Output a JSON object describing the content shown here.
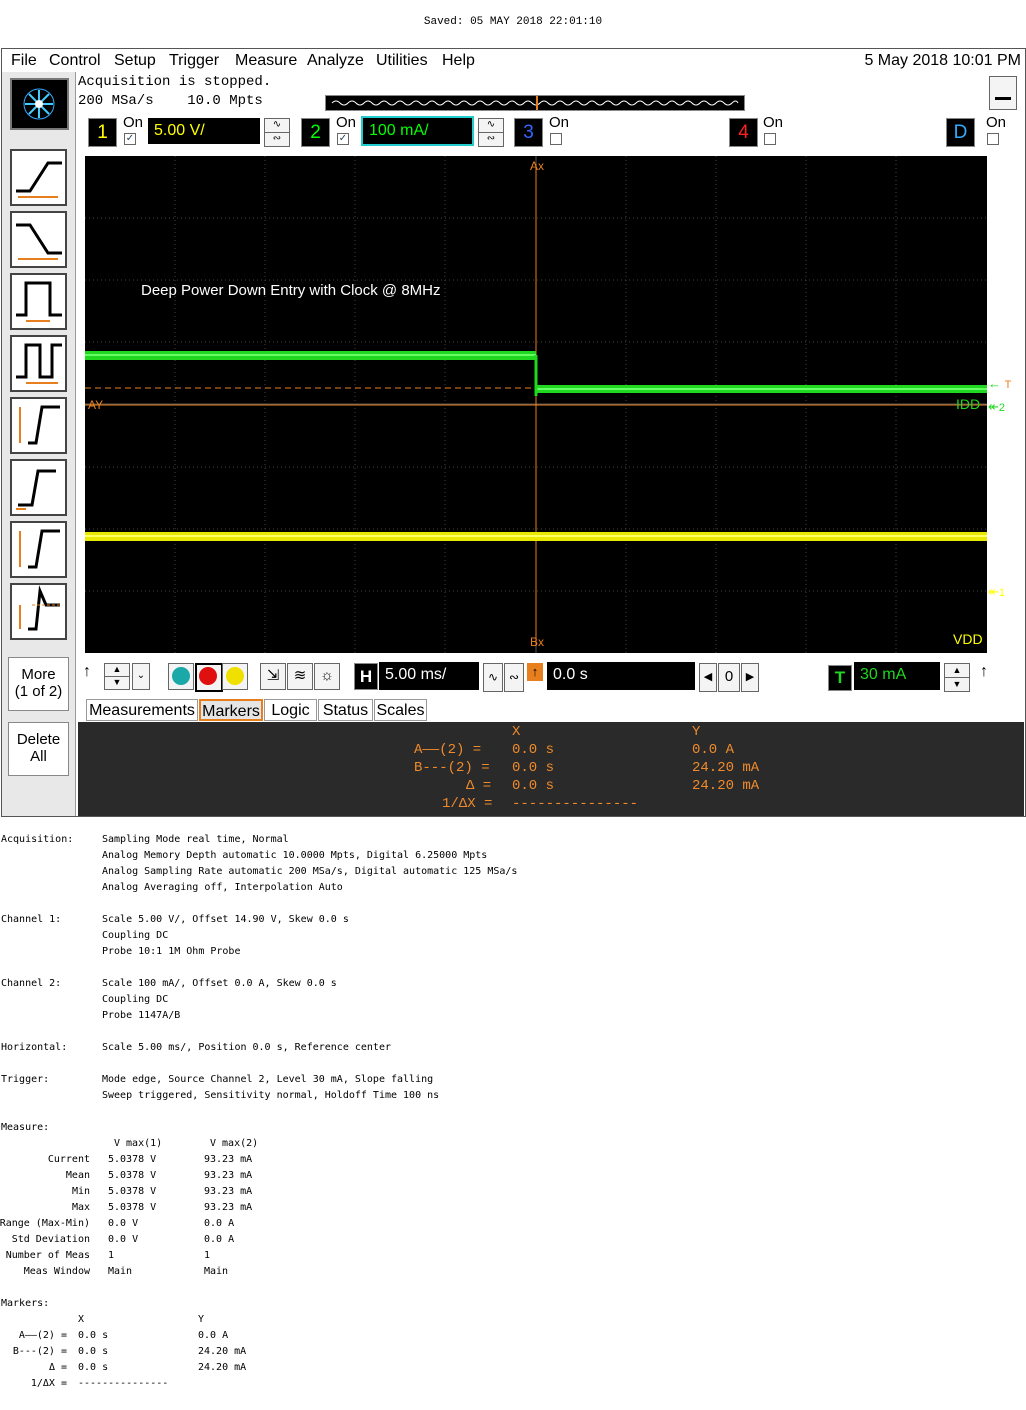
{
  "saved": "Saved:  05 MAY 2018  22:01:10",
  "menu": [
    "File",
    "Control",
    "Setup",
    "Trigger",
    "Measure",
    "Analyze",
    "Utilities",
    "Help"
  ],
  "datetime": "5 May 2018 10:01 PM",
  "acquisition": {
    "status": "Acquisition is stopped.",
    "rate": "200 MSa/s    10.0 Mpts"
  },
  "left_buttons": {
    "more": "More\n(1 of 2)",
    "delete": "Delete\nAll"
  },
  "channels": [
    {
      "num": "1",
      "on": "On",
      "scale": "5.00 V/",
      "color": "#ffff00"
    },
    {
      "num": "2",
      "on": "On",
      "scale": "100 mA/",
      "color": "#00ff00"
    },
    {
      "num": "3",
      "on": "On",
      "color": "#3060ff"
    },
    {
      "num": "4",
      "on": "On",
      "color": "#ff2020"
    },
    {
      "num": "D",
      "on": "On",
      "color": "#20a0ff"
    }
  ],
  "graticule": {
    "annotation": "Deep Power Down Entry with Clock @ 8MHz",
    "ax": "Ax",
    "bx": "Bx",
    "ay": "AY",
    "idd": "IDD",
    "vdd": "VDD",
    "trig_marker": "T",
    "ch2_marker": "2",
    "ch1_marker": "1"
  },
  "horizontal": {
    "h": "H",
    "scale": "5.00 ms/",
    "position": "0.0 s",
    "ref": "0"
  },
  "trigger": {
    "t": "T",
    "level": "30 mA"
  },
  "tabs": [
    "Measurements",
    "Markers",
    "Logic",
    "Status",
    "Scales"
  ],
  "markers_panel": {
    "x_hdr": "X",
    "y_hdr": "Y",
    "rows": [
      {
        "label": "A——(2) =",
        "x": "0.0 s",
        "y": "0.0 A"
      },
      {
        "label": "B---(2) =",
        "x": "0.0 s",
        "y": "24.20 mA"
      },
      {
        "label": "Δ =",
        "x": "0.0 s",
        "y": "24.20 mA"
      },
      {
        "label": "1/ΔX =",
        "x": "---------------",
        "y": ""
      }
    ]
  },
  "report": {
    "acq_label": "Acquisition:",
    "acq_lines": [
      "Sampling Mode real time, Normal",
      "Analog Memory Depth automatic 10.0000 Mpts, Digital 6.25000 Mpts",
      "Analog Sampling Rate automatic 200 MSa/s, Digital automatic 125 MSa/s",
      "Analog Averaging off, Interpolation Auto"
    ],
    "ch1_label": "Channel 1:",
    "ch1_lines": [
      "Scale 5.00 V/, Offset 14.90 V, Skew 0.0 s",
      "Coupling DC",
      "Probe 10:1 1M Ohm Probe"
    ],
    "ch2_label": "Channel 2:",
    "ch2_lines": [
      "Scale 100 mA/, Offset 0.0 A, Skew 0.0 s",
      "Coupling DC",
      "Probe 1147A/B"
    ],
    "hor_label": "Horizontal:",
    "hor_lines": [
      "Scale 5.00 ms/, Position 0.0 s, Reference center"
    ],
    "trig_label": "Trigger:",
    "trig_lines": [
      "Mode edge, Source Channel 2, Level 30 mA, Slope falling",
      "Sweep triggered, Sensitivity normal, Holdoff Time 100 ns"
    ],
    "meas_label": "Measure:",
    "meas_hdr": [
      "V max(1)",
      "V max(2)"
    ],
    "meas_rows": [
      [
        "Current",
        "5.0378 V",
        "93.23 mA"
      ],
      [
        "Mean",
        "5.0378 V",
        "93.23 mA"
      ],
      [
        "Min",
        "5.0378 V",
        "93.23 mA"
      ],
      [
        "Max",
        "5.0378 V",
        "93.23 mA"
      ],
      [
        "Range (Max-Min)",
        "0.0 V",
        "0.0 A"
      ],
      [
        "Std Deviation",
        "0.0 V",
        "0.0 A"
      ],
      [
        "Number of Meas",
        "1",
        "1"
      ],
      [
        "Meas Window",
        "Main",
        "Main"
      ]
    ],
    "mark_label": "Markers:",
    "mark_hdr": [
      "X",
      "Y"
    ],
    "mark_rows": [
      [
        "A——(2) =",
        "0.0 s",
        "0.0 A"
      ],
      [
        "B---(2) =",
        "0.0 s",
        "24.20 mA"
      ],
      [
        "Δ =",
        "0.0 s",
        "24.20 mA"
      ],
      [
        "1/ΔX =",
        "---------------",
        ""
      ]
    ]
  }
}
